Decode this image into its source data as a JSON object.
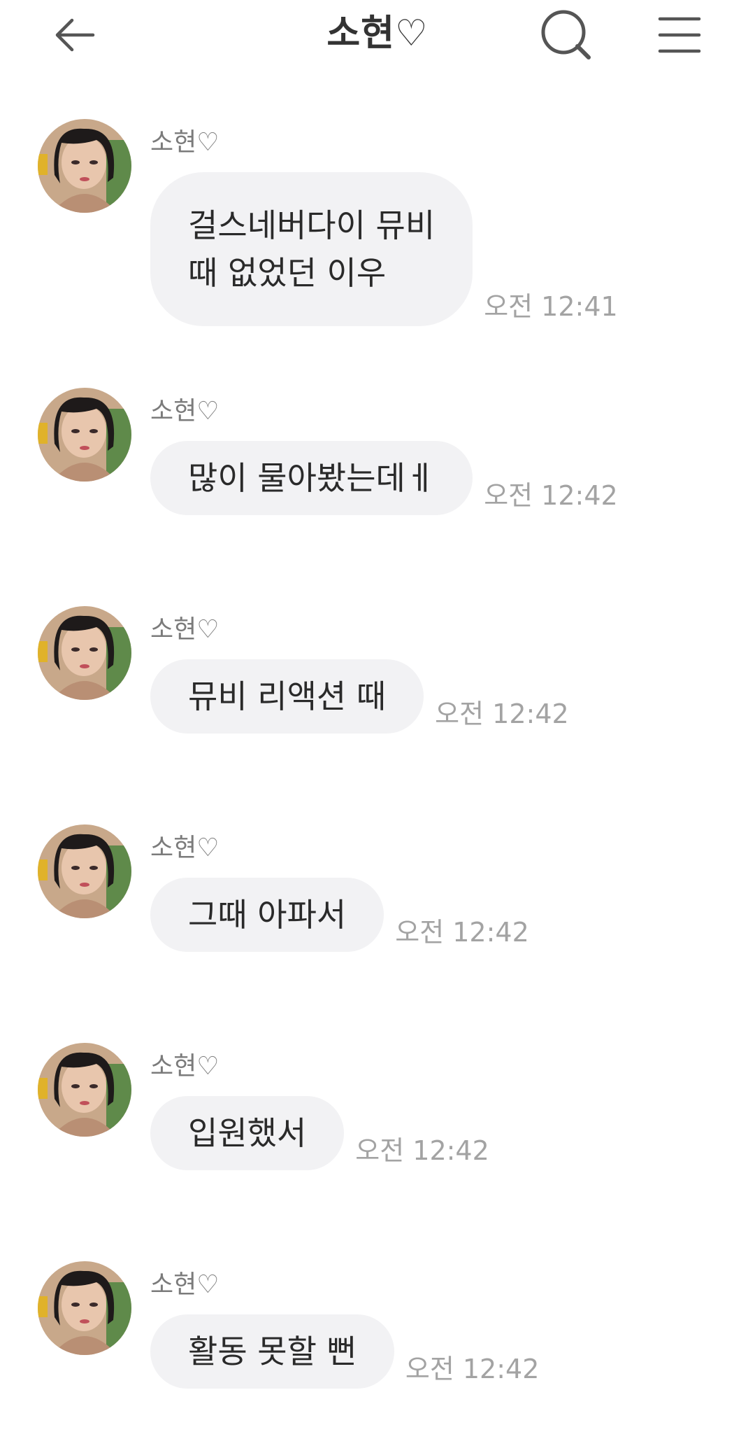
{
  "header": {
    "title": "소현♡",
    "back_icon": "back-arrow-icon",
    "search_icon": "search-icon",
    "menu_icon": "hamburger-menu-icon"
  },
  "messages": [
    {
      "sender": "소현♡",
      "text": "걸스네버다이 뮤비\n때 없었던 이우",
      "time": "오전 12:41"
    },
    {
      "sender": "소현♡",
      "text": "많이 물아봤는데ㅔ",
      "time": "오전 12:42"
    },
    {
      "sender": "소현♡",
      "text": "뮤비 리액션 때",
      "time": "오전 12:42"
    },
    {
      "sender": "소현♡",
      "text": "그때 아파서",
      "time": "오전 12:42"
    },
    {
      "sender": "소현♡",
      "text": "입원했서",
      "time": "오전 12:42"
    },
    {
      "sender": "소현♡",
      "text": "활동 못할 뻔",
      "time": "오전 12:42"
    }
  ],
  "colors": {
    "bubble": "#f2f2f4",
    "sender_text": "#7b7b7b",
    "time_text": "#a3a3a3",
    "title_text": "#333333"
  }
}
